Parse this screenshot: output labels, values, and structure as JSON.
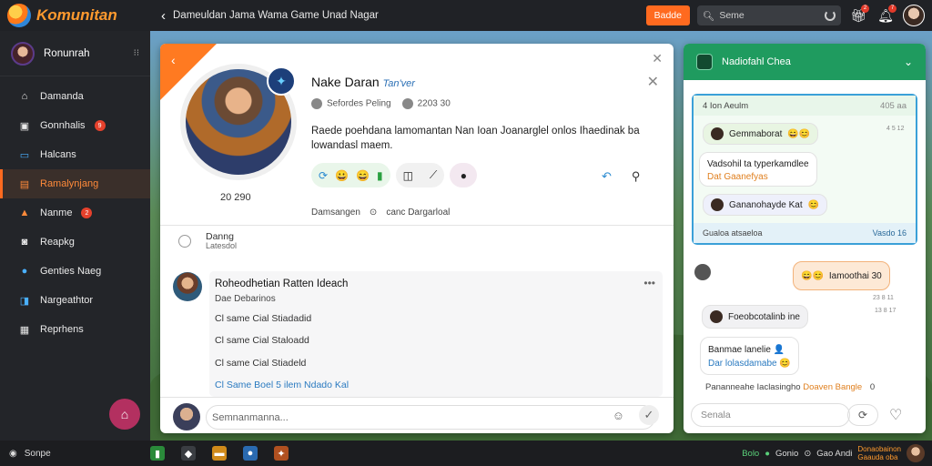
{
  "app": {
    "name": "Komunitan"
  },
  "topbar": {
    "breadcrumb": "Dameuldan Jama Wama Game Unad Nagar",
    "primary_button": "Badde",
    "search_value": "Seme",
    "notif_count_1": "2",
    "notif_count_2": "7"
  },
  "sidebar": {
    "user_name": "Ronunrah",
    "items": [
      {
        "label": "Damanda",
        "icon": "home-icon"
      },
      {
        "label": "Gonnhalis",
        "icon": "chat-icon",
        "badge": "9"
      },
      {
        "label": "Halcans",
        "icon": "monitor-icon"
      },
      {
        "label": "Ramalynjang",
        "icon": "flag-icon",
        "active": true
      },
      {
        "label": "Nanme",
        "icon": "warning-icon",
        "badge": "2"
      },
      {
        "label": "Reapkg",
        "icon": "camera-icon"
      },
      {
        "label": "Genties Naeg",
        "icon": "globe-icon"
      },
      {
        "label": "Nargeathtor",
        "icon": "share-icon"
      },
      {
        "label": "Reprhens",
        "icon": "table-icon"
      }
    ]
  },
  "card": {
    "hero_count": "20 290",
    "name": "Nake Daran",
    "tag": "Tan'ver",
    "meta_1": "Sefordes Peling",
    "meta_2": "2203 30",
    "description": "Raede poehdana lamomantan Nan Ioan Joanarglel onlos Ihaedinak ba lowandasl maem.",
    "game_line_1": "Damsangen",
    "game_line_2": "canc Dargarloal",
    "sub_title": "Danng",
    "sub_subtitle": "Latesdol",
    "post_title": "Roheodhetian Ratten Ideach",
    "post_subtitle": "Dae Debarinos",
    "post_lines": [
      "Cl same Cial Stiadadid",
      "Cl same Cial Staloadd",
      "Cl same Cial Stiadeld"
    ],
    "post_link": "Cl Same Boel 5 ilem Ndado Kal",
    "compose_placeholder": "Semnanmanna..."
  },
  "rpanel": {
    "header_title": "Nadiofahl Chea",
    "thread_title": "4 Ion Aeulm",
    "thread_time": "405 aa",
    "b1": "Gemmaborat",
    "b1_time": "4 5 12",
    "b2_line1": "Vadsohil ta typerkamdlee",
    "b2_line2": "Dat Gaanefyas",
    "b3": "Gananohayde Kat",
    "thread_foot_left": "Gualoa atsaeloa",
    "thread_foot_right": "Vasdo 16",
    "c1": "Iamoothai 30",
    "c1_time": "23 8 11",
    "c2": "Foeobcotalinb ine",
    "c2_time": "13 8 17",
    "c3_line1": "Banmae lanelie",
    "c3_line2": "Dar lolasdamabe",
    "footer_line": "Pananneahe Iaclasingho",
    "footer_hl": "Doaven Bangle",
    "footer_count": "0",
    "input_placeholder": "Senala"
  },
  "bottombar": {
    "left_label": "Sonpe",
    "status_1": "Bolo",
    "status_2": "Gonio",
    "status_3": "Gao Andi",
    "status_hl_1": "Donaobainon",
    "status_hl_2": "Gaauda oba"
  }
}
